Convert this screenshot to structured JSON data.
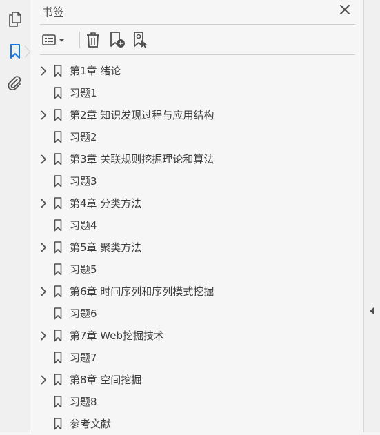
{
  "panel": {
    "title": "书签",
    "close_icon": "close-icon"
  },
  "left_rail": {
    "items": [
      {
        "icon": "pages-icon"
      },
      {
        "icon": "bookmark-icon",
        "active": true
      },
      {
        "icon": "attachment-icon"
      }
    ]
  },
  "toolbar": {
    "options_icon": "options-menu-icon",
    "delete_icon": "delete-bookmark-icon",
    "new_icon": "new-bookmark-icon",
    "find_icon": "find-current-bookmark-icon"
  },
  "bookmarks": [
    {
      "label": "第1章 绪论",
      "expandable": true,
      "underlined": false
    },
    {
      "label": "习题1",
      "expandable": false,
      "underlined": true
    },
    {
      "label": "第2章 知识发现过程与应用结构",
      "expandable": true,
      "underlined": false
    },
    {
      "label": "习题2",
      "expandable": false,
      "underlined": false
    },
    {
      "label": "第3章 关联规则挖掘理论和算法",
      "expandable": true,
      "underlined": false
    },
    {
      "label": "习题3",
      "expandable": false,
      "underlined": false
    },
    {
      "label": "第4章 分类方法",
      "expandable": true,
      "underlined": false
    },
    {
      "label": "习题4",
      "expandable": false,
      "underlined": false
    },
    {
      "label": "第5章 聚类方法",
      "expandable": true,
      "underlined": false
    },
    {
      "label": "习题5",
      "expandable": false,
      "underlined": false
    },
    {
      "label": "第6章 时间序列和序列模式挖掘",
      "expandable": true,
      "underlined": false
    },
    {
      "label": "习题6",
      "expandable": false,
      "underlined": false
    },
    {
      "label": "第7章 Web挖掘技术",
      "expandable": true,
      "underlined": false
    },
    {
      "label": "习题7",
      "expandable": false,
      "underlined": false
    },
    {
      "label": "第8章 空间挖掘",
      "expandable": true,
      "underlined": false
    },
    {
      "label": "习题8",
      "expandable": false,
      "underlined": false
    },
    {
      "label": "参考文献",
      "expandable": false,
      "underlined": false
    }
  ],
  "colors": {
    "accent": "#1473e6",
    "icon": "#505050"
  }
}
